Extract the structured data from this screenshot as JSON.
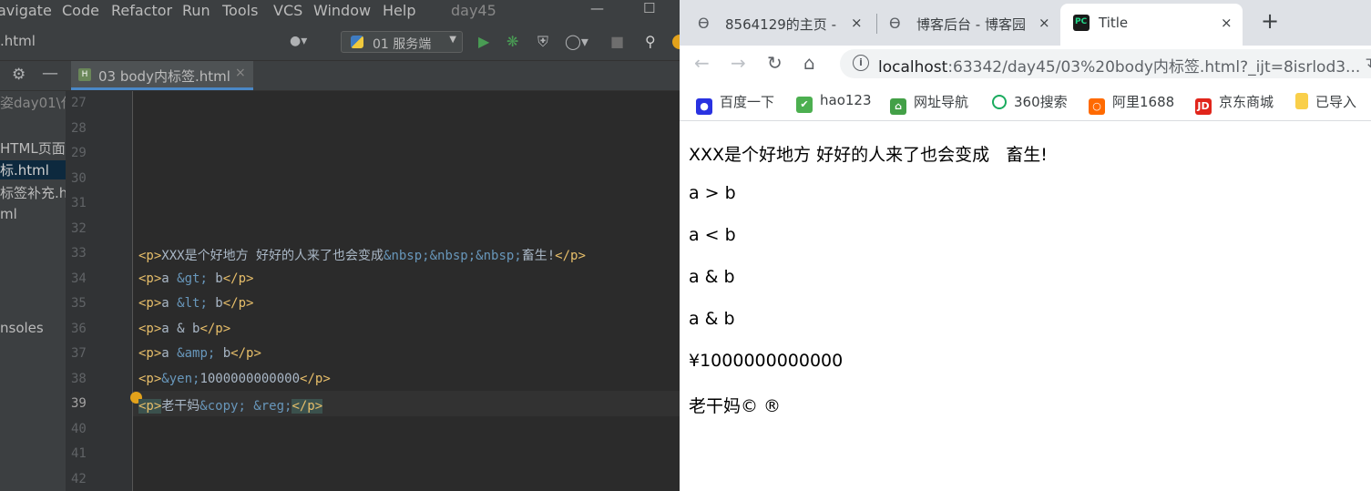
{
  "ide": {
    "menu": [
      "avigate",
      "Code",
      "Refactor",
      "Run",
      "Tools",
      "VCS",
      "Window",
      "Help"
    ],
    "project_name": "day45",
    "window_controls": [
      "—",
      "☐"
    ],
    "toolbar": {
      "file_name": ".html",
      "run_config": "01 服务端"
    },
    "tab": {
      "label": "03 body内标签.html",
      "close": "×"
    },
    "project_panel": [
      {
        "text": "姿day01\\代"
      },
      {
        "text": "HTML页面."
      },
      {
        "text": "标.html"
      },
      {
        "text": "标签补充.h"
      },
      {
        "text": "ml"
      },
      {
        "text": "nsoles"
      }
    ],
    "line_numbers": [
      "27",
      "28",
      "29",
      "30",
      "31",
      "32",
      "33",
      "34",
      "35",
      "36",
      "37",
      "38",
      "39",
      "40",
      "41",
      "42"
    ],
    "current_line": "39",
    "code_lines": [
      {
        "open": "<p>",
        "text": "XXX是个好地方 好好的人来了也会变成",
        "entity": "&nbsp;&nbsp;&nbsp;",
        "text2": "畜生!",
        "close": "</p>"
      },
      {
        "open": "<p>",
        "text": "a ",
        "entity": "&gt;",
        "text2": " b",
        "close": "</p>"
      },
      {
        "open": "<p>",
        "text": "a ",
        "entity": "&lt;",
        "text2": " b",
        "close": "</p>"
      },
      {
        "open": "<p>",
        "text": "a & b",
        "entity": "",
        "text2": "",
        "close": "</p>"
      },
      {
        "open": "<p>",
        "text": "a ",
        "entity": "&amp;",
        "text2": " b",
        "close": "</p>"
      },
      {
        "open": "<p>",
        "text": "",
        "entity": "&yen;",
        "text2": "1000000000000",
        "close": "</p>"
      },
      {
        "open": "<p>",
        "text": "老干妈",
        "entity": "&copy; &reg;",
        "text2": "",
        "close": "</p>"
      }
    ]
  },
  "browser": {
    "tabs": [
      {
        "label": "8564129的主页 -",
        "close": "×"
      },
      {
        "label": "博客后台 - 博客园",
        "close": "×"
      },
      {
        "label": "Title",
        "close": "×"
      }
    ],
    "new_tab": "+",
    "url_host": "localhost",
    "url_path": ":63342/day45/03%20body内标签.html?_ijt=8isrlod3...",
    "bookmarks": [
      "百度一下",
      "hao123",
      "网址导航",
      "360搜索",
      "阿里1688",
      "京东商城",
      "已导入"
    ],
    "page_paragraphs": [
      "XXX是个好地方 好好的人来了也会变成   畜生!",
      "a > b",
      "a < b",
      "a & b",
      "a & b",
      "¥1000000000000",
      "老干妈© ®"
    ]
  },
  "colors": {
    "ide_bg": "#2b2b2b",
    "ide_panel": "#3c3f41",
    "tag": "#e8bf6a",
    "entity": "#6897bb",
    "text": "#a9b7c6",
    "run_green": "#499c54",
    "browser_tabstrip": "#dee1e6"
  }
}
